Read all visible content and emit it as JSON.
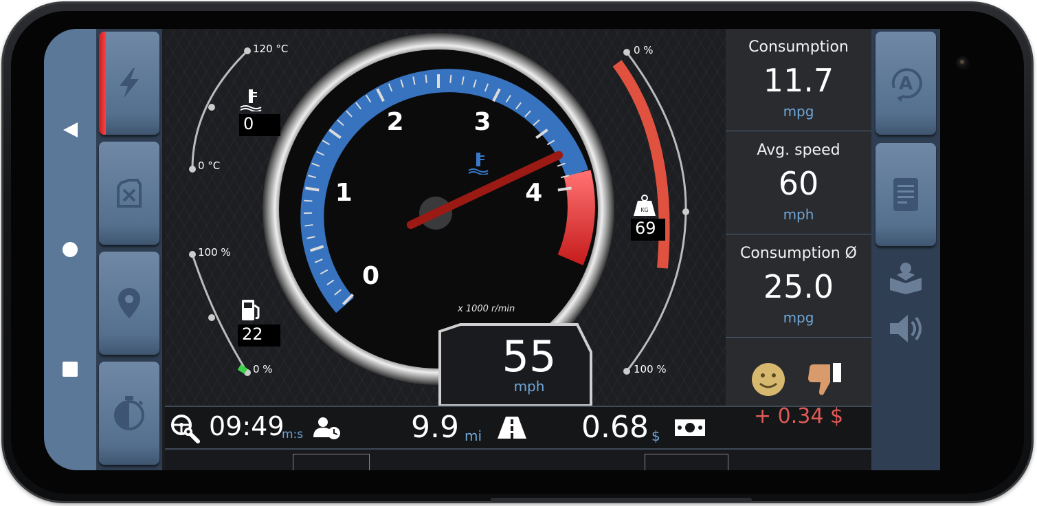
{
  "gauges": {
    "rpm": {
      "ticks": [
        "0",
        "1",
        "2",
        "3",
        "4"
      ],
      "unit_label": "x 1000 r/min",
      "needle_value": 3.7
    },
    "coolant": {
      "max_label": "120 °C",
      "min_label": "0 °C",
      "value": "0",
      "icon": "thermometer-icon"
    },
    "fuel": {
      "max_label": "100 %",
      "min_label": "0 %",
      "value": "22",
      "icon": "fuel-pump-icon",
      "level_fraction": 0.22
    },
    "load": {
      "top_label": "0 %",
      "bottom_label": "100 %",
      "value": "69",
      "icon": "weight-icon",
      "bar_color": "#e0523f"
    }
  },
  "speed": {
    "value": "55",
    "unit": "mph"
  },
  "bottom_bar": {
    "trip_time": {
      "value": "09:49",
      "unit": "m:s"
    },
    "distance": {
      "value": "9.9",
      "unit": "mi"
    },
    "cost": {
      "value": "0.68",
      "unit": "$"
    }
  },
  "info_panel": [
    {
      "title": "Consumption",
      "value": "11.7",
      "unit": "mpg"
    },
    {
      "title": "Avg. speed",
      "value": "60",
      "unit": "mph"
    },
    {
      "title": "Consumption Ø",
      "value": "25.0",
      "unit": "mpg"
    }
  ],
  "rating": {
    "delta": "+ 0.34 $",
    "delta_color": "#e05a56"
  },
  "colors": {
    "accent_blue": "#3a79c9",
    "accent_red": "#e34040",
    "panel_blue": "#5c7898"
  }
}
